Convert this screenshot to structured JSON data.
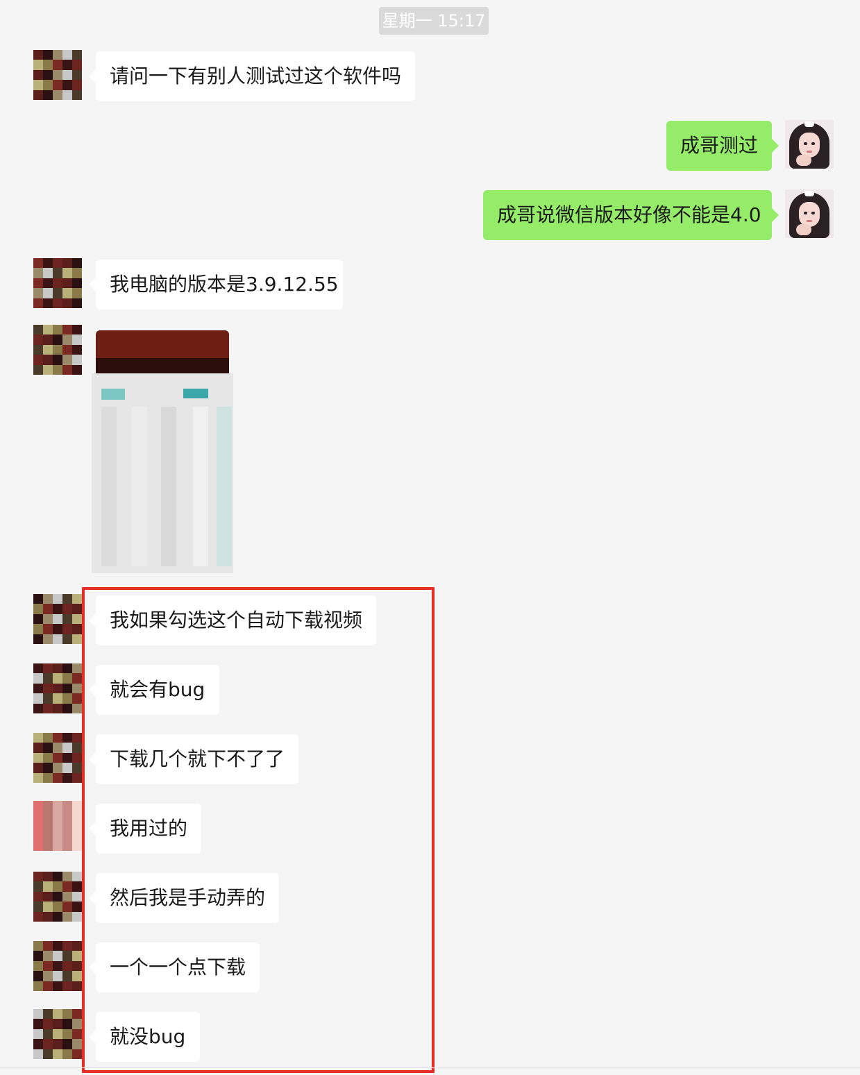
{
  "chat": {
    "timestamp": "星期一 15:17",
    "messages": [
      {
        "side": "left",
        "text": "请问一下有别人测试过这个软件吗"
      },
      {
        "side": "right",
        "text": "成哥测过"
      },
      {
        "side": "right",
        "text": "成哥说微信版本好像不能是4.0"
      },
      {
        "side": "left",
        "text": "我电脑的版本是3.9.12.55"
      },
      {
        "side": "left",
        "type": "image"
      },
      {
        "side": "left",
        "text": "我如果勾选这个自动下载视频"
      },
      {
        "side": "left",
        "text": "就会有bug"
      },
      {
        "side": "left",
        "text": "下载几个就下不了了"
      },
      {
        "side": "left",
        "text": "我用过的"
      },
      {
        "side": "left",
        "text": "然后我是手动弄的"
      },
      {
        "side": "left",
        "text": "一个一个点下载"
      },
      {
        "side": "left",
        "text": "就没bug"
      }
    ]
  },
  "colors": {
    "background": "#f5f5f5",
    "own_bubble": "#95ec69",
    "other_bubble": "#ffffff",
    "highlight_frame": "#e53028"
  }
}
